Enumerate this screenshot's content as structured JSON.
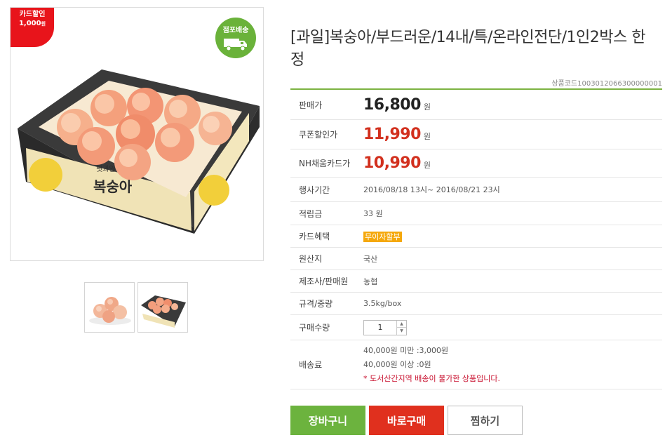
{
  "badges": {
    "card_discount_title": "카드할인",
    "card_discount_amount": "1,000",
    "card_discount_unit": "원",
    "shipping": "점포배송"
  },
  "images": {
    "main_label": "복숭아",
    "box_label": "햇과일",
    "thumbnails": [
      "peaches-loose",
      "peaches-box"
    ]
  },
  "product": {
    "title": "[과일]복숭아/부드러운/14내/특/온라인전단/1인2박스 한정",
    "code": "상품코드1003012066300000001"
  },
  "info": {
    "sale_price_label": "판매가",
    "sale_price": "16,800",
    "coupon_price_label": "쿠폰할인가",
    "coupon_price": "11,990",
    "nh_card_price_label": "NH채움카드가",
    "nh_card_price": "10,990",
    "currency": "원",
    "event_period_label": "행사기간",
    "event_period": "2016/08/18 13시~ 2016/08/21 23시",
    "points_label": "적립금",
    "points": "33 원",
    "card_benefit_label": "카드혜택",
    "card_benefit": "무이자할부",
    "origin_label": "원산지",
    "origin": "국산",
    "maker_label": "제조사/판매원",
    "maker": "농협",
    "spec_label": "규격/중량",
    "spec": "3.5kg/box",
    "qty_label": "구매수량",
    "qty": "1",
    "shipping_label": "배송료",
    "shipping_under": "40,000원 미만 :3,000원",
    "shipping_over": "40,000원 이상 :0원",
    "shipping_note": "* 도서산간지역 배송이 불가한 상품입니다."
  },
  "buttons": {
    "cart": "장바구니",
    "buy": "바로구매",
    "wish": "찜하기"
  },
  "colors": {
    "accent_green": "#6cb33e",
    "accent_red": "#e0301e",
    "price_red": "#d2301e",
    "badge_red": "#e8141b"
  }
}
